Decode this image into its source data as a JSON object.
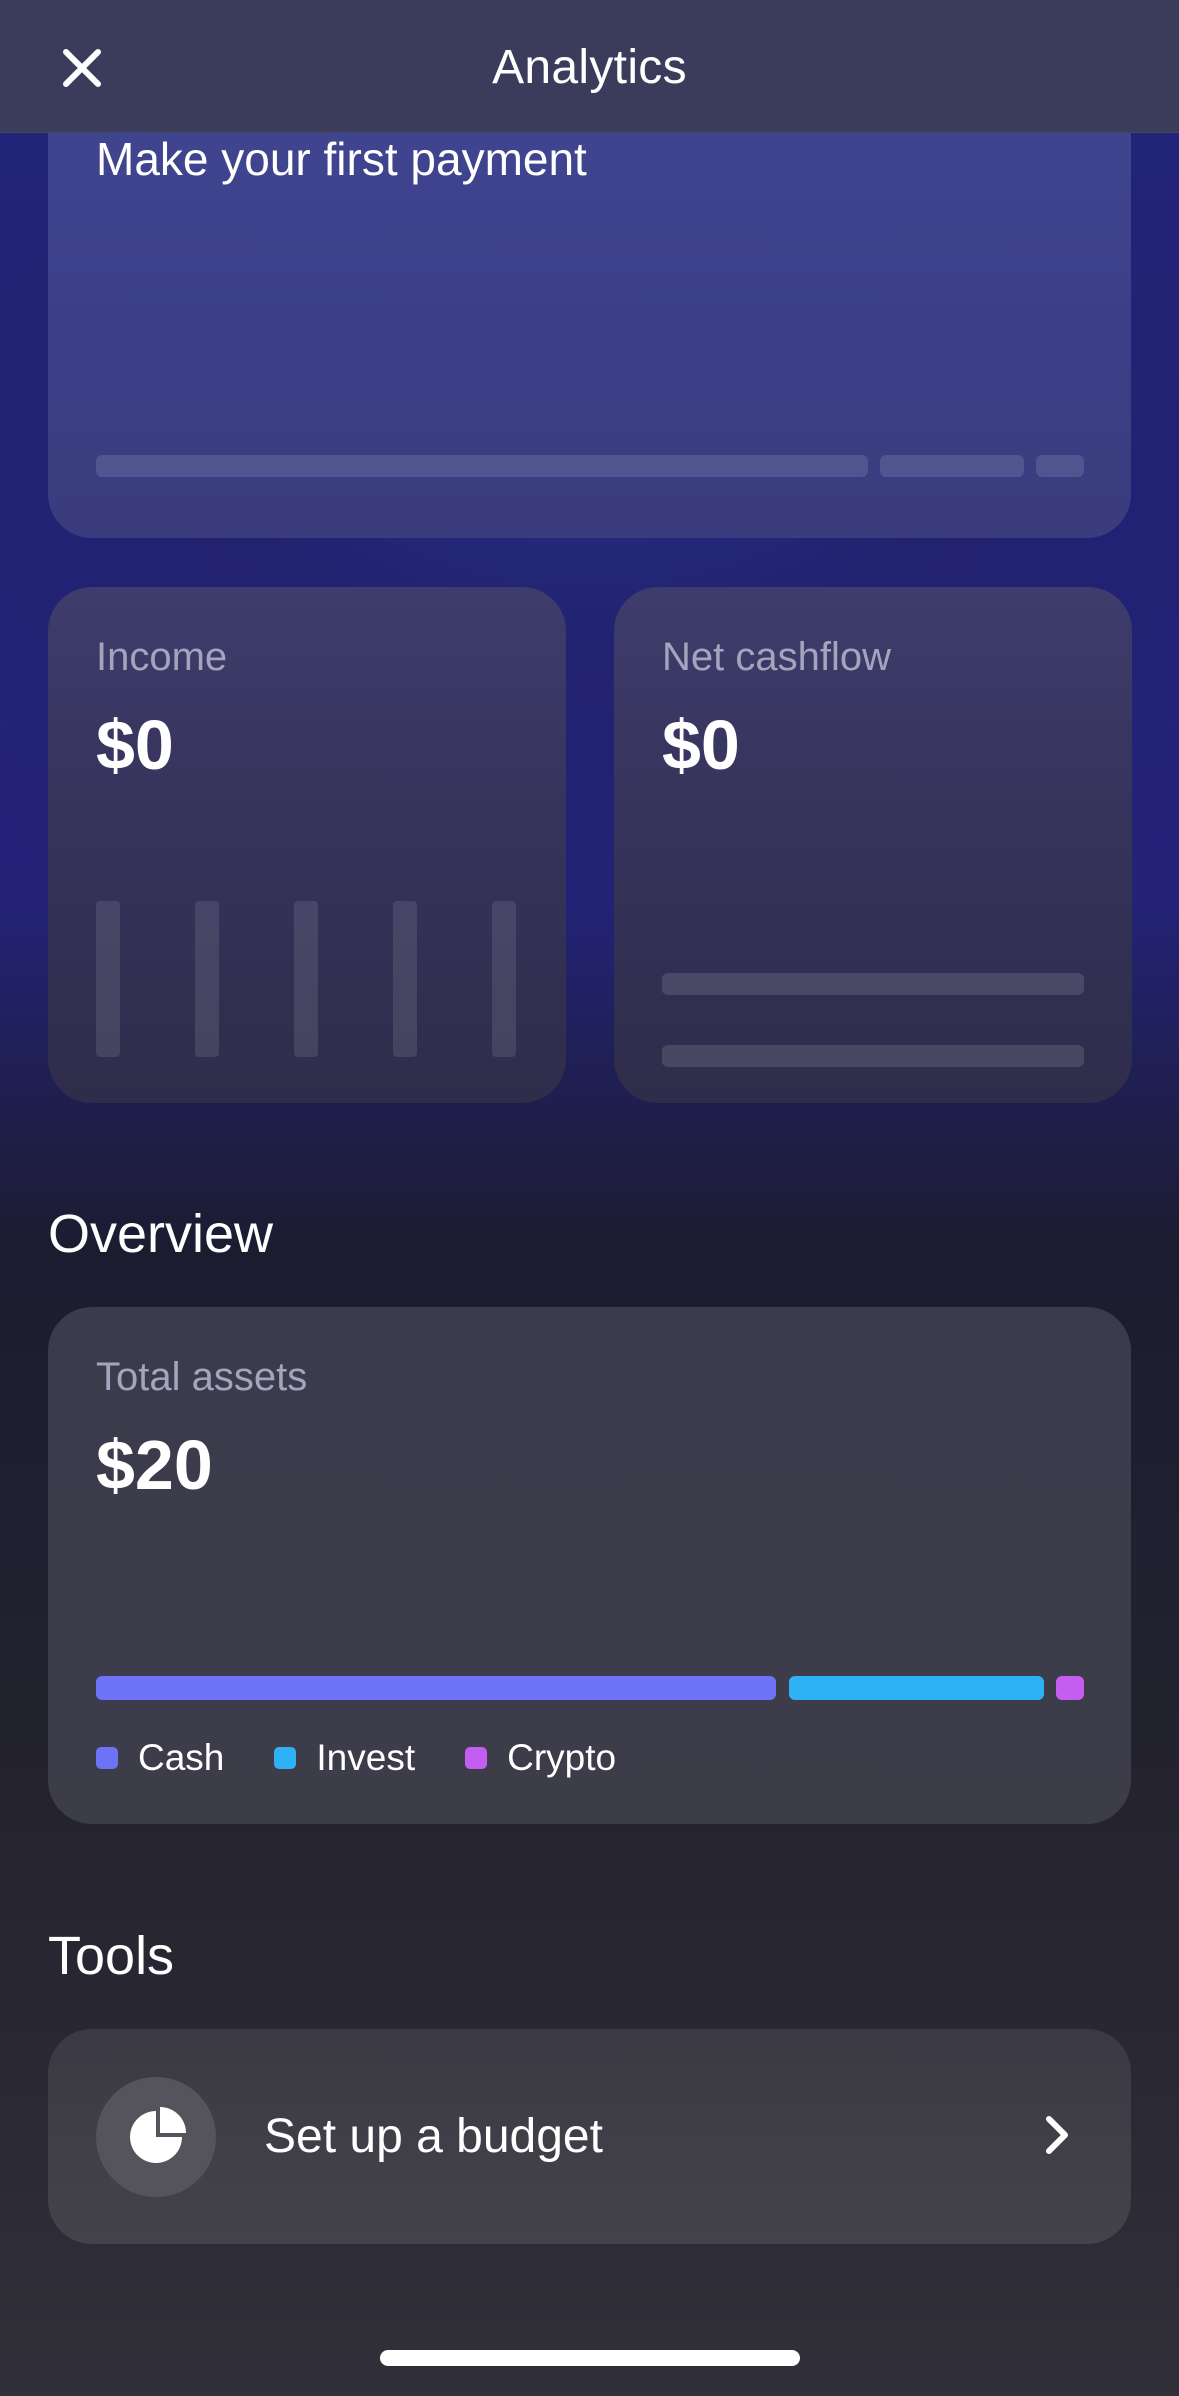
{
  "header": {
    "title": "Analytics",
    "close_icon": "close-icon"
  },
  "payment_card": {
    "title": "Make your first payment"
  },
  "income": {
    "label": "Income",
    "value": "$0"
  },
  "cashflow": {
    "label": "Net cashflow",
    "value": "$0"
  },
  "overview": {
    "section_title": "Overview",
    "total_assets_label": "Total assets",
    "total_assets_value": "$20",
    "breakdown": [
      {
        "name": "Cash",
        "color": "#6d73f6"
      },
      {
        "name": "Invest",
        "color": "#2fb2f5"
      },
      {
        "name": "Crypto",
        "color": "#c35ef0"
      }
    ]
  },
  "tools": {
    "section_title": "Tools",
    "budget_label": "Set up a budget",
    "budget_icon": "pie-chart-icon",
    "chevron_icon": "chevron-right-icon"
  }
}
